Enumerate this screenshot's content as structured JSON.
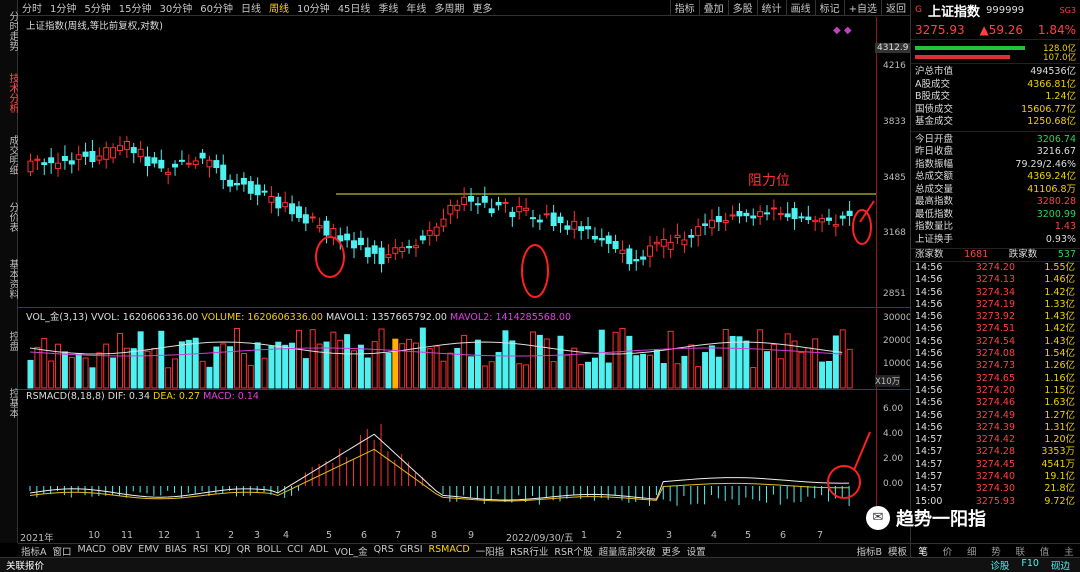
{
  "left_tabs": [
    "分时走势",
    "技术分析",
    "成交明细",
    "分价表",
    "基本资料",
    "控盘",
    "控基本"
  ],
  "periods": [
    "分时",
    "1分钟",
    "5分钟",
    "15分钟",
    "30分钟",
    "60分钟",
    "日线",
    "周线",
    "10分钟",
    "45日线",
    "季线",
    "年线",
    "多周期",
    "更多"
  ],
  "active_period": "周线",
  "right_tools": [
    "指标",
    "叠加",
    "多股",
    "统计",
    "画线",
    "标记",
    "+自选",
    "返回"
  ],
  "main": {
    "caption": "上证指数(周线,等比前复权,对数)",
    "max_label": "4312.9",
    "min_label": "2851",
    "resistance": "阻力位",
    "y_ticks": [
      "4216",
      "3833",
      "3485",
      "3168",
      "2851"
    ]
  },
  "vol": {
    "caption_name": "VOL_金(3,13)",
    "vvol": "VVOL: 1620606336.00",
    "volume": "VOLUME: 1620606336.00",
    "mavol1": "MAVOL1: 1357665792.00",
    "mavol2": "MAVOL2: 1414285568.00",
    "unit": "X10万",
    "y_ticks": [
      "30000",
      "20000",
      "10000"
    ]
  },
  "macd": {
    "caption_name": "RSMACD(8,18,8)",
    "dif": "DIF: 0.34",
    "dea": "DEA: 0.27",
    "macd": "MACD: 0.14",
    "y_ticks": [
      "6.00",
      "4.00",
      "2.00",
      "0.00"
    ]
  },
  "x_labels": [
    "2021年",
    "10",
    "11",
    "12",
    "1",
    "2",
    "3",
    "4",
    "5",
    "6",
    "7",
    "8",
    "9",
    "2022/09/30/五",
    "1",
    "2",
    "3",
    "4",
    "5",
    "6",
    "7"
  ],
  "bottom_tabs": [
    "指标A",
    "窗口",
    "MACD",
    "OBV",
    "EMV",
    "BIAS",
    "RSI",
    "KDJ",
    "QR",
    "BOLL",
    "CCI",
    "ADL",
    "VOL_金",
    "QRS",
    "GRSI",
    "RSMACD",
    "一阳指",
    "RSR行业",
    "RSR个股",
    "超量底部突破",
    "更多",
    "设置"
  ],
  "active_bottom": "RSMACD",
  "bottom_right": [
    "指标B",
    "模板"
  ],
  "status": {
    "left": "关联报价",
    "right": [
      "诊股",
      "F10",
      "砚边"
    ]
  },
  "quote": {
    "name": "上证指数",
    "code": "999999",
    "tag": "SG3",
    "price": "3275.93",
    "change": "▲59.26",
    "pct": "1.84%",
    "bar1": "128.0亿",
    "bar2": "107.0亿",
    "rows1": [
      [
        "沪总市值",
        "494536亿",
        "white"
      ],
      [
        "A股成交",
        "4366.81亿",
        "yellow"
      ],
      [
        "B股成交",
        "1.24亿",
        "yellow"
      ],
      [
        "国债成交",
        "15606.77亿",
        "yellow"
      ],
      [
        "基金成交",
        "1250.68亿",
        "yellow"
      ]
    ],
    "rows2": [
      [
        "今日开盘",
        "3206.74",
        "green"
      ],
      [
        "昨日收盘",
        "3216.67",
        "white"
      ],
      [
        "指数振幅",
        "79.29/2.46%",
        "white"
      ],
      [
        "总成交额",
        "4369.24亿",
        "yellow"
      ],
      [
        "总成交量",
        "41106.8万",
        "yellow"
      ],
      [
        "最高指数",
        "3280.28",
        "red"
      ],
      [
        "最低指数",
        "3200.99",
        "green"
      ],
      [
        "指数量比",
        "1.43",
        "red"
      ],
      [
        "上证换手",
        "0.93%",
        "white"
      ]
    ],
    "updown": {
      "up_label": "涨家数",
      "up": "1681",
      "down_label": "跌家数",
      "down": "537"
    },
    "ticks": [
      [
        "14:56",
        "3274.20",
        "1.55亿"
      ],
      [
        "14:56",
        "3274.13",
        "1.46亿"
      ],
      [
        "14:56",
        "3274.34",
        "1.42亿"
      ],
      [
        "14:56",
        "3274.19",
        "1.33亿"
      ],
      [
        "14:56",
        "3273.92",
        "1.43亿"
      ],
      [
        "14:56",
        "3274.51",
        "1.42亿"
      ],
      [
        "14:56",
        "3274.54",
        "1.43亿"
      ],
      [
        "14:56",
        "3274.08",
        "1.54亿"
      ],
      [
        "14:56",
        "3274.73",
        "1.26亿"
      ],
      [
        "14:56",
        "3274.65",
        "1.16亿"
      ],
      [
        "14:56",
        "3274.20",
        "1.15亿"
      ],
      [
        "14:56",
        "3274.46",
        "1.63亿"
      ],
      [
        "14:56",
        "3274.49",
        "1.27亿"
      ],
      [
        "14:56",
        "3274.39",
        "1.31亿"
      ],
      [
        "14:57",
        "3274.42",
        "1.20亿"
      ],
      [
        "14:57",
        "3274.28",
        "3353万"
      ],
      [
        "14:57",
        "3274.45",
        "4541万"
      ],
      [
        "14:57",
        "3274.40",
        "19.1亿"
      ],
      [
        "14:57",
        "3274.30",
        "21.8亿"
      ],
      [
        "15:00",
        "3275.93",
        "9.72亿"
      ]
    ],
    "foot": [
      "笔",
      "价",
      "细",
      "势",
      "联",
      "值",
      "主"
    ]
  },
  "watermark": "趋势一阳指"
}
